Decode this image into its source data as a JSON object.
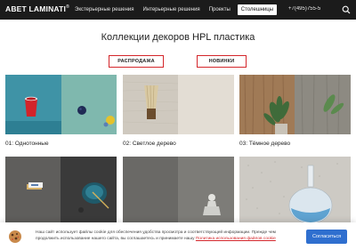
{
  "header": {
    "logo": "ABET LAMINATI",
    "logo_mark": "®",
    "nav": [
      {
        "label": "Экстерьерные решения"
      },
      {
        "label": "Интерьерные решения"
      },
      {
        "label": "Проекты"
      },
      {
        "label": "Столешницы"
      }
    ],
    "phone": "+7(495)755-5",
    "icons": {
      "search": "search-icon"
    }
  },
  "page": {
    "title": "Коллекции декоров HPL пластика"
  },
  "filters": {
    "sale": "РАСПРОДАЖА",
    "new": "НОВИНКИ"
  },
  "gallery": {
    "items": [
      {
        "label": "01: Однотонные"
      },
      {
        "label": "02: Светлое дерево"
      },
      {
        "label": "03: Тёмное дерево"
      },
      {
        "label": ""
      },
      {
        "label": ""
      },
      {
        "label": ""
      }
    ]
  },
  "cookie": {
    "text": "Наш сайт использует файлы cookie для обеспечения удобства просмотра и соответствующей информации. Прежде чем продолжить использование нашего сайта, вы соглашаетесь и принимаете нашу",
    "link": "Политика использования файлов cookie",
    "accept": "Согласиться",
    "icons": {
      "cookie": "cookie-icon"
    }
  },
  "colors": {
    "header_bg": "#1b1b1b",
    "accent_red": "#d4262b",
    "accept_blue": "#2f6fcf"
  }
}
